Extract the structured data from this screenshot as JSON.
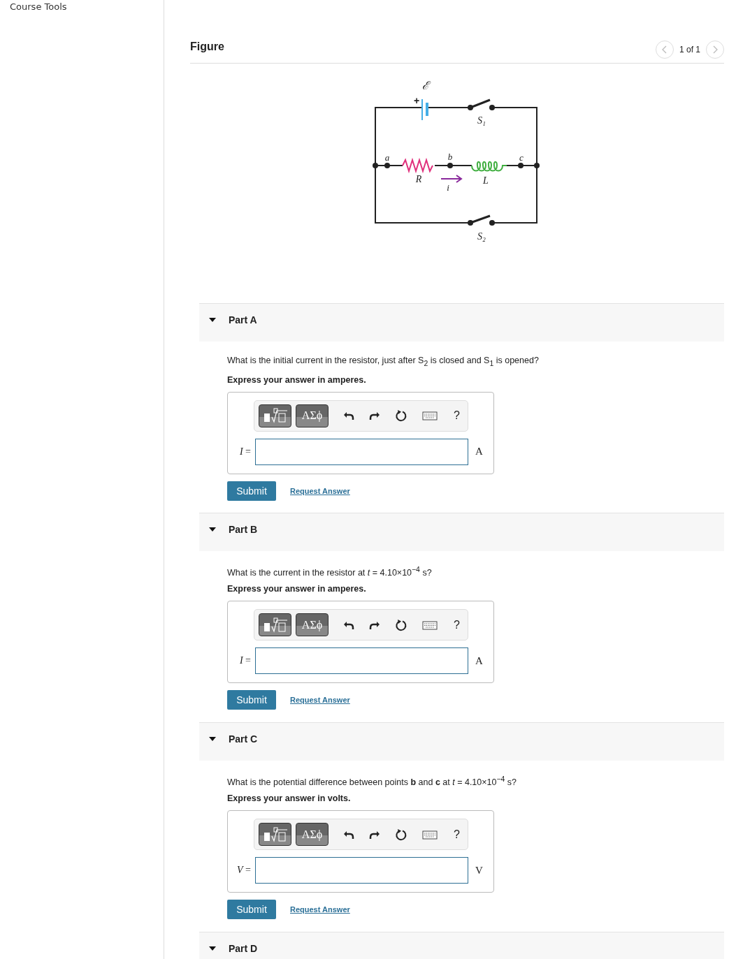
{
  "sidebar": {
    "title": "Course Tools"
  },
  "figure": {
    "title": "Figure",
    "pager": "1 of 1",
    "labels": [
      {
        "kind": "emf",
        "text": "ℰ"
      },
      {
        "kind": "plus",
        "text": "+"
      },
      {
        "kind": "s1",
        "text": "S₁"
      },
      {
        "kind": "a",
        "text": "a"
      },
      {
        "kind": "b",
        "text": "b"
      },
      {
        "kind": "c",
        "text": "c"
      },
      {
        "kind": "R",
        "text": "R"
      },
      {
        "kind": "i",
        "text": "i"
      },
      {
        "kind": "L",
        "text": "L"
      },
      {
        "kind": "s2",
        "text": "S₂"
      }
    ]
  },
  "parts": [
    {
      "title": "Part A",
      "expanded": true,
      "greek": "ΑΣϕ",
      "help": "?",
      "question": "What is the initial current in the resistor, just after S$_{2}$ is closed and S$_{1}$ is opened?",
      "instruction": "Express your answer in amperes.",
      "variable": "*I* =",
      "unit": "A",
      "submit": "Submit",
      "request": "Request Answer"
    },
    {
      "title": "Part B",
      "expanded": true,
      "greek": "ΑΣϕ",
      "help": "?",
      "question": "What is the current in the resistor at *t* = 4.10×10$^{−4}$ s?",
      "instruction": "Express your answer in amperes.",
      "variable": "*I* =",
      "unit": "A",
      "submit": "Submit",
      "request": "Request Answer"
    },
    {
      "title": "Part C",
      "expanded": true,
      "greek": "ΑΣϕ",
      "help": "?",
      "question": "What is the potential difference between points **b** and **c** at *t* = 4.10×10$^{−4}$ s?",
      "instruction": "Express your answer in volts.",
      "variable": "*V* =",
      "unit": "V",
      "submit": "Submit",
      "request": "Request Answer"
    },
    {
      "title": "Part D"
    }
  ]
}
